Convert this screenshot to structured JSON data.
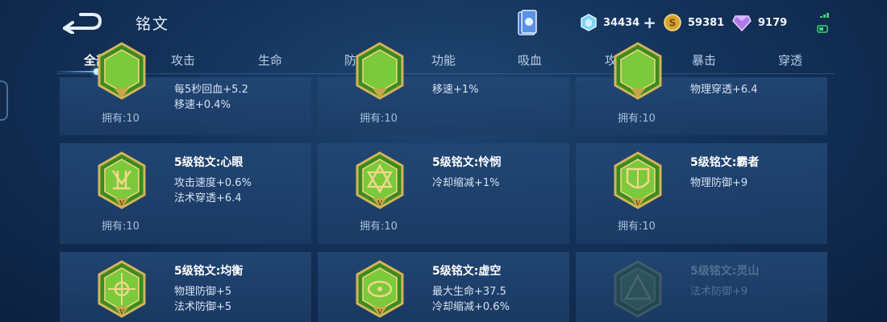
{
  "header": {
    "title": "铭文"
  },
  "currency": {
    "diamond": "34434",
    "gold": "59381",
    "gem": "9179",
    "plus": "+"
  },
  "tabs": [
    "全部",
    "攻击",
    "生命",
    "防御",
    "功能",
    "吸血",
    "攻速",
    "暴击",
    "穿透"
  ],
  "active_tab": 0,
  "cards": [
    {
      "name": "",
      "attrs": [
        "每5秒回血+5.2",
        "移速+0.4%"
      ],
      "owned": "拥有:10"
    },
    {
      "name": "",
      "attrs": [
        "移速+1%"
      ],
      "owned": "拥有:10"
    },
    {
      "name": "",
      "attrs": [
        "物理穿透+6.4"
      ],
      "owned": "拥有:10"
    },
    {
      "name": "5级铭文:心眼",
      "attrs": [
        "攻击速度+0.6%",
        "法术穿透+6.4"
      ],
      "owned": "拥有:10"
    },
    {
      "name": "5级铭文:怜悯",
      "attrs": [
        "冷却缩减+1%"
      ],
      "owned": "拥有:10"
    },
    {
      "name": "5级铭文:霸者",
      "attrs": [
        "物理防御+9"
      ],
      "owned": "拥有:10"
    },
    {
      "name": "5级铭文:均衡",
      "attrs": [
        "物理防御+5",
        "法术防御+5"
      ],
      "owned": ""
    },
    {
      "name": "5级铭文:虚空",
      "attrs": [
        "最大生命+37.5",
        "冷却缩减+0.6%"
      ],
      "owned": ""
    },
    {
      "name": "5级铭文:灵山",
      "attrs": [
        "法术防御+9"
      ],
      "owned": ""
    }
  ],
  "colors": {
    "background": "#13325a",
    "card": "#23487a",
    "inscription_green": "#5cae2a",
    "gold_frame": "#c8a545"
  }
}
